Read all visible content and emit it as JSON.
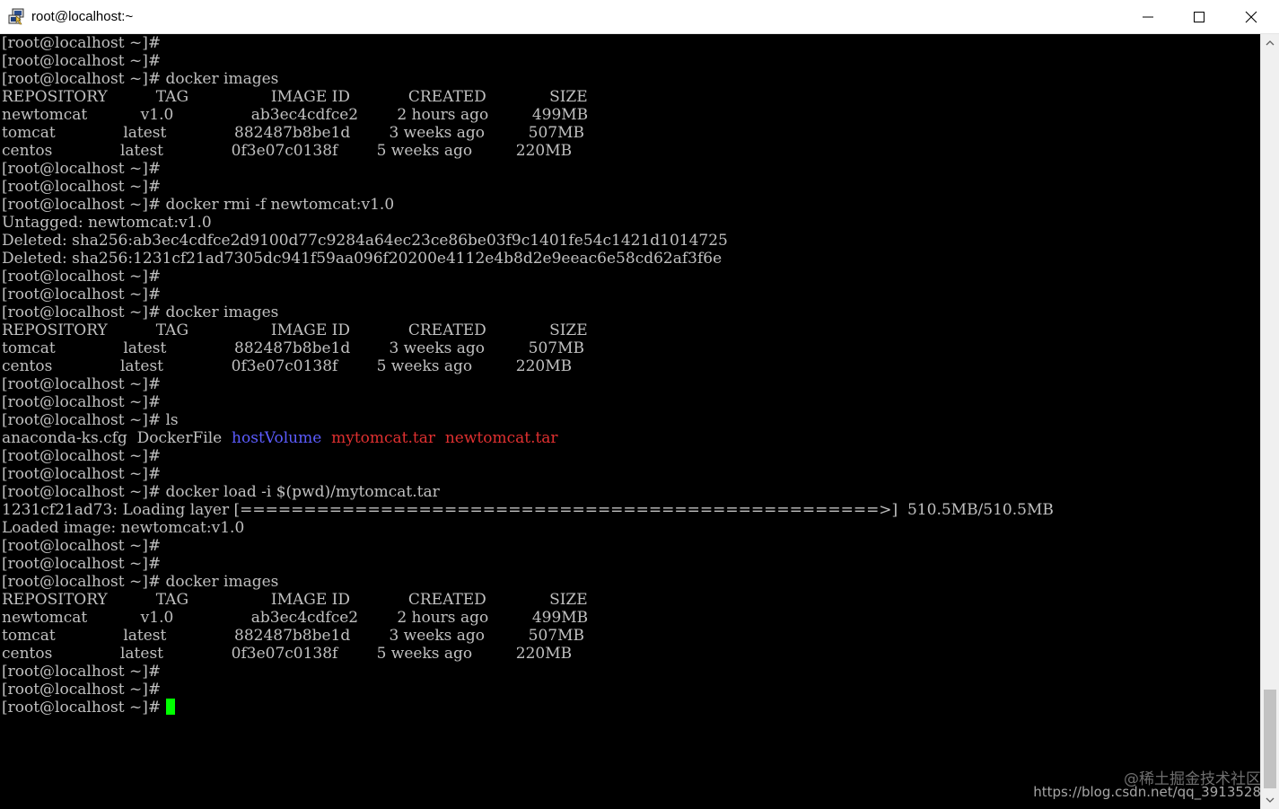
{
  "window": {
    "title": "root@localhost:~"
  },
  "icons": {
    "app": "putty-terminal-icon",
    "minimize": "minimize-icon",
    "maximize": "maximize-icon",
    "close": "close-icon"
  },
  "colors": {
    "background": "#000000",
    "foreground": "#c0c0c0",
    "directory": "#5c5cff",
    "archive": "#e03030",
    "cursor": "#00ff00"
  },
  "terminal": {
    "lines": [
      [
        {
          "text": "[root@localhost ~]#"
        }
      ],
      [
        {
          "text": "[root@localhost ~]#"
        }
      ],
      [
        {
          "text": "[root@localhost ~]# docker images"
        }
      ],
      [
        {
          "text": "REPOSITORY          TAG                 IMAGE ID            CREATED             SIZE"
        }
      ],
      [
        {
          "text": "newtomcat           v1.0                ab3ec4cdfce2        2 hours ago         499MB"
        }
      ],
      [
        {
          "text": "tomcat              latest              882487b8be1d        3 weeks ago         507MB"
        }
      ],
      [
        {
          "text": "centos              latest              0f3e07c0138f        5 weeks ago         220MB"
        }
      ],
      [
        {
          "text": "[root@localhost ~]#"
        }
      ],
      [
        {
          "text": "[root@localhost ~]#"
        }
      ],
      [
        {
          "text": "[root@localhost ~]# docker rmi -f newtomcat:v1.0"
        }
      ],
      [
        {
          "text": "Untagged: newtomcat:v1.0"
        }
      ],
      [
        {
          "text": "Deleted: sha256:ab3ec4cdfce2d9100d77c9284a64ec23ce86be03f9c1401fe54c1421d1014725"
        }
      ],
      [
        {
          "text": "Deleted: sha256:1231cf21ad7305dc941f59aa096f20200e4112e4b8d2e9eeac6e58cd62af3f6e"
        }
      ],
      [
        {
          "text": "[root@localhost ~]#"
        }
      ],
      [
        {
          "text": "[root@localhost ~]#"
        }
      ],
      [
        {
          "text": "[root@localhost ~]# docker images"
        }
      ],
      [
        {
          "text": "REPOSITORY          TAG                 IMAGE ID            CREATED             SIZE"
        }
      ],
      [
        {
          "text": "tomcat              latest              882487b8be1d        3 weeks ago         507MB"
        }
      ],
      [
        {
          "text": "centos              latest              0f3e07c0138f        5 weeks ago         220MB"
        }
      ],
      [
        {
          "text": "[root@localhost ~]#"
        }
      ],
      [
        {
          "text": "[root@localhost ~]#"
        }
      ],
      [
        {
          "text": "[root@localhost ~]# ls"
        }
      ],
      [
        {
          "text": "anaconda-ks.cfg  DockerFile  "
        },
        {
          "text": "hostVolume",
          "color": "blue"
        },
        {
          "text": "  "
        },
        {
          "text": "mytomcat.tar",
          "color": "red"
        },
        {
          "text": "  "
        },
        {
          "text": "newtomcat.tar",
          "color": "red"
        }
      ],
      [
        {
          "text": "[root@localhost ~]#"
        }
      ],
      [
        {
          "text": "[root@localhost ~]#"
        }
      ],
      [
        {
          "text": "[root@localhost ~]# docker load -i $(pwd)/mytomcat.tar"
        }
      ],
      [
        {
          "text": "1231cf21ad73: Loading layer [==================================================>]  510.5MB/510.5MB"
        }
      ],
      [
        {
          "text": "Loaded image: newtomcat:v1.0"
        }
      ],
      [
        {
          "text": "[root@localhost ~]#"
        }
      ],
      [
        {
          "text": "[root@localhost ~]#"
        }
      ],
      [
        {
          "text": "[root@localhost ~]# docker images"
        }
      ],
      [
        {
          "text": "REPOSITORY          TAG                 IMAGE ID            CREATED             SIZE"
        }
      ],
      [
        {
          "text": "newtomcat           v1.0                ab3ec4cdfce2        2 hours ago         499MB"
        }
      ],
      [
        {
          "text": "tomcat              latest              882487b8be1d        3 weeks ago         507MB"
        }
      ],
      [
        {
          "text": "centos              latest              0f3e07c0138f        5 weeks ago         220MB"
        }
      ],
      [
        {
          "text": "[root@localhost ~]#"
        }
      ],
      [
        {
          "text": "[root@localhost ~]#"
        }
      ],
      [
        {
          "text": "[root@localhost ~]# "
        },
        {
          "cursor": true
        }
      ]
    ]
  },
  "watermark": {
    "line1": "@稀土掘金技术社区",
    "line2": "https://blog.csdn.net/qq_3913528"
  }
}
